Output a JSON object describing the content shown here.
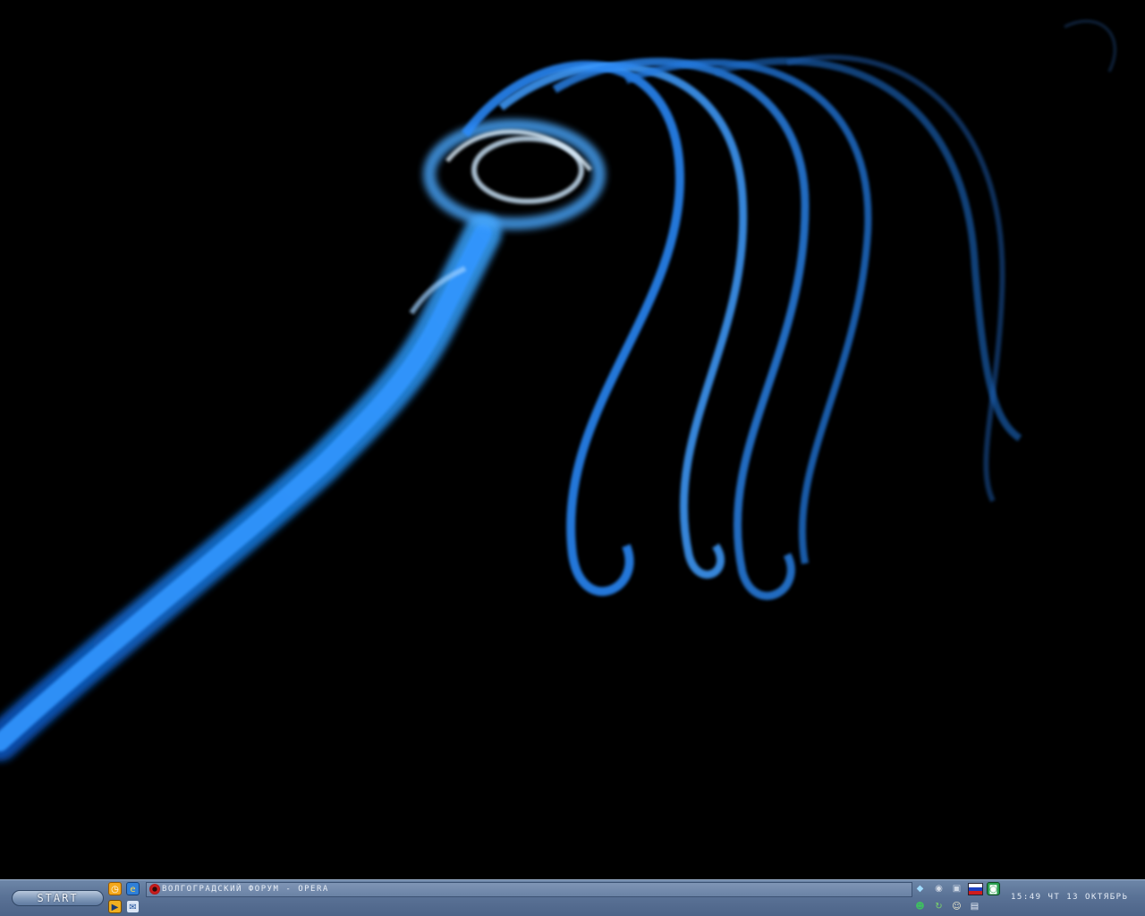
{
  "desktop": {
    "wallpaper": "blue smoke swirl on black background",
    "colors": {
      "background": "#000000",
      "smoke_primary": "#1a7de0",
      "smoke_highlight": "#bfe4ff"
    }
  },
  "taskbar": {
    "start_label": "START",
    "quick_launch": [
      {
        "icon": "clock-icon"
      },
      {
        "icon": "internet-explorer-icon"
      },
      {
        "icon": "media-player-icon"
      },
      {
        "icon": "outlook-express-icon"
      }
    ],
    "task": {
      "icon": "opera-icon",
      "label": "ВОЛГОГРАДСКИЙ ФОРУМ - OPERA"
    },
    "tray_icons": [
      "network-icon",
      "volume-icon",
      "monitor-icon",
      "language-flag-ru-icon",
      "app-green-icon",
      "messenger-icon",
      "update-icon",
      "smiley-icon",
      "disk-icon"
    ],
    "clock": "15:49 ЧТ 13 ОКТЯБРЬ",
    "colors": {
      "bar": "#5a7296",
      "text": "#e6edf7"
    }
  }
}
